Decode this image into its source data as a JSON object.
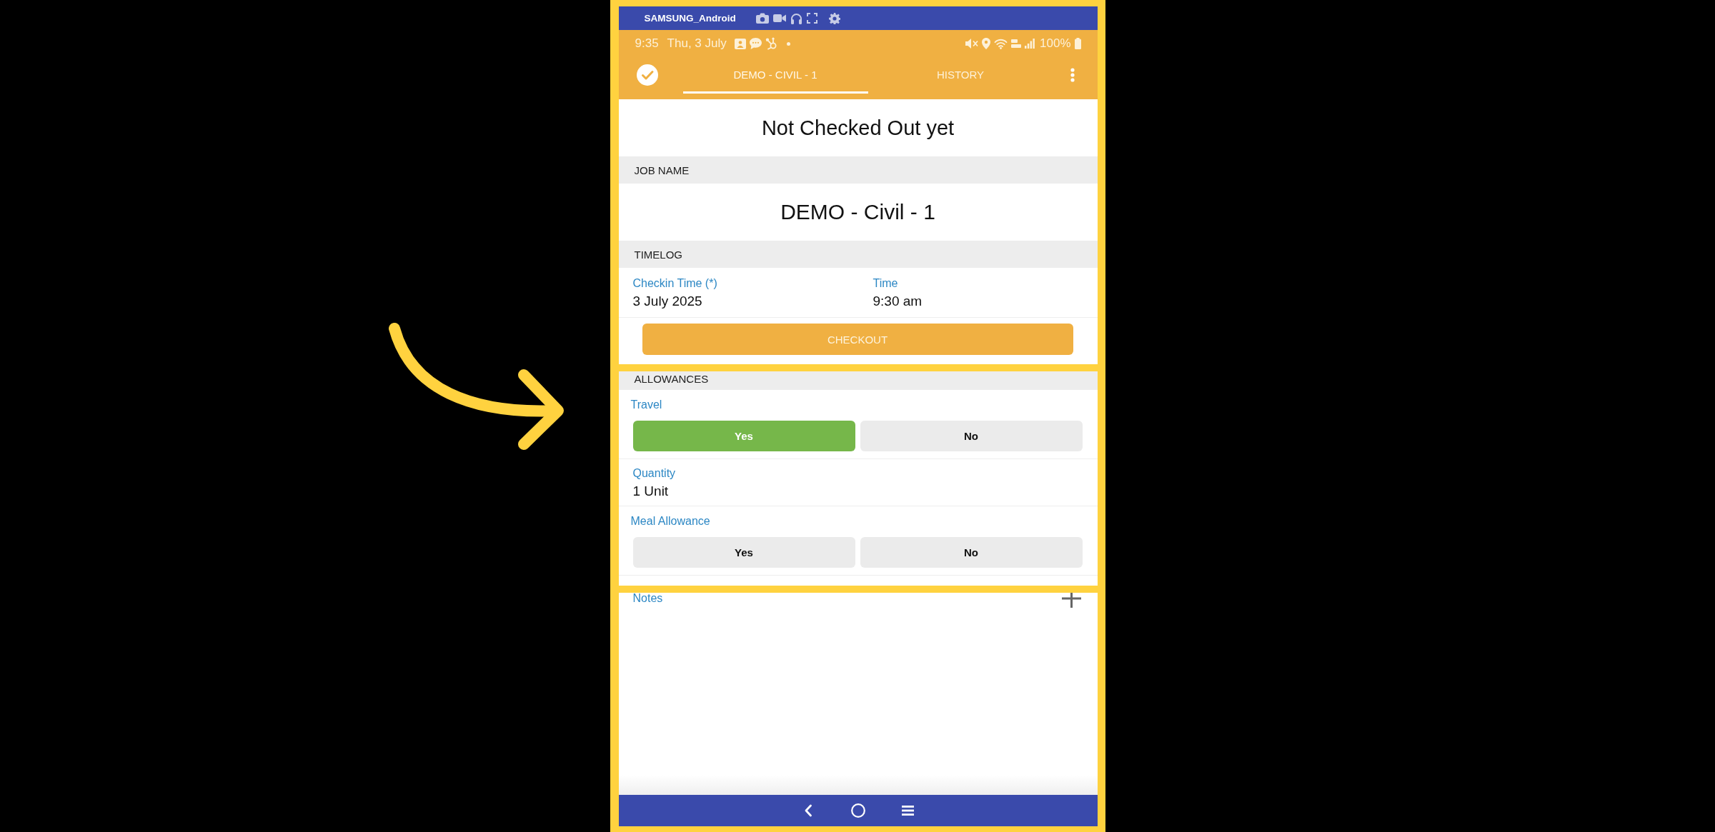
{
  "device_bar": {
    "title": "SAMSUNG_Android"
  },
  "status_bar": {
    "time": "9:35",
    "date": "Thu, 3 July",
    "battery": "100%"
  },
  "app_bar": {
    "tabs": [
      {
        "label": "DEMO - CIVIL - 1",
        "selected": true
      },
      {
        "label": "HISTORY",
        "selected": false
      }
    ]
  },
  "status_title": "Not Checked Out yet",
  "sections": [
    {
      "kind": "job",
      "header": "JOB NAME",
      "value": "DEMO - Civil - 1",
      "highlighted": false
    },
    {
      "kind": "timelog",
      "header": "TIMELOG",
      "fields": [
        {
          "label": "Checkin Time (*)",
          "value": "3 July 2025"
        },
        {
          "label": "Time",
          "value": "9:30 am"
        }
      ],
      "button": "CHECKOUT",
      "highlighted": false
    },
    {
      "kind": "allowances",
      "header": "ALLOWANCES",
      "highlighted": true,
      "items": [
        {
          "kind": "choice",
          "label": "Travel",
          "options": [
            {
              "label": "Yes",
              "selected": true
            },
            {
              "label": "No",
              "selected": false
            }
          ]
        },
        {
          "kind": "value",
          "label": "Quantity",
          "value": "1 Unit"
        },
        {
          "kind": "choice",
          "label": "Meal Allowance",
          "options": [
            {
              "label": "Yes",
              "selected": false
            },
            {
              "label": "No",
              "selected": false
            }
          ]
        }
      ]
    },
    {
      "kind": "notes",
      "label": "Notes",
      "highlighted": false
    }
  ]
}
